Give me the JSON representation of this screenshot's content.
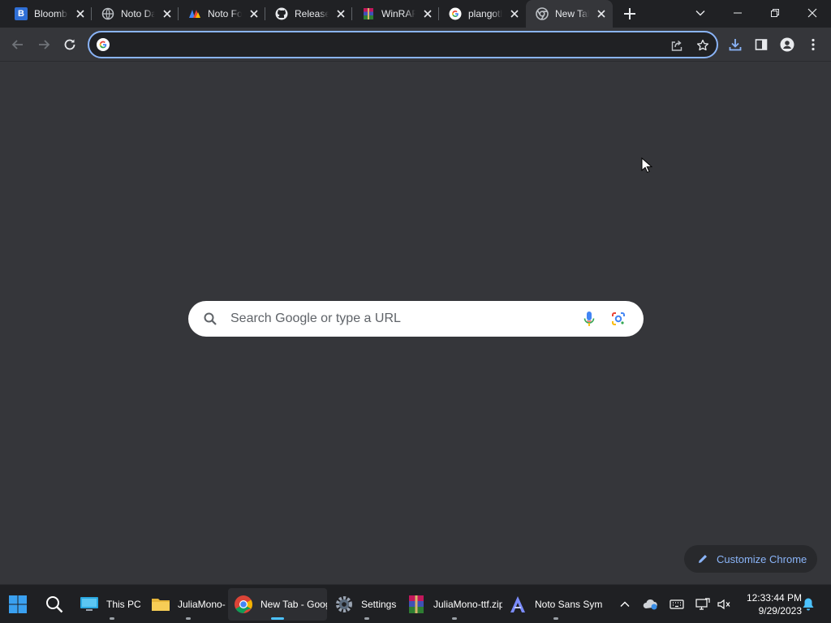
{
  "tabs": [
    {
      "title": "Bloomberg",
      "favicon": "bloomberg-b-icon",
      "active": false
    },
    {
      "title": "Noto Daily",
      "favicon": "globe-icon",
      "active": false
    },
    {
      "title": "Noto Fonts",
      "favicon": "noto-fonts-icon",
      "active": false
    },
    {
      "title": "Releases",
      "favicon": "github-icon",
      "active": false
    },
    {
      "title": "WinRAR",
      "favicon": "winrar-icon",
      "active": false
    },
    {
      "title": "plangothic",
      "favicon": "google-g-icon",
      "active": false
    },
    {
      "title": "New Tab",
      "favicon": "chrome-icon",
      "active": true
    }
  ],
  "omnibox": {
    "value": "",
    "placeholder": ""
  },
  "ntp": {
    "search_placeholder": "Search Google or type a URL",
    "customize_label": "Customize Chrome"
  },
  "taskbar": {
    "items": [
      {
        "label": "This PC",
        "icon": "monitor-icon"
      },
      {
        "label": "JuliaMono-ttf",
        "icon": "folder-icon"
      },
      {
        "label": "New Tab - Google Chrome",
        "icon": "chrome-icon",
        "active": true
      },
      {
        "label": "Settings",
        "icon": "settings-gear-icon"
      },
      {
        "label": "JuliaMono-ttf.zip",
        "icon": "winrar-icon"
      },
      {
        "label": "Noto Sans Symbols",
        "icon": "font-viewer-icon"
      }
    ],
    "time": "12:33:44 PM",
    "date": "9/29/2023"
  },
  "colors": {
    "frame": "#202124",
    "toolbar": "#35363a",
    "accent": "#8ab4f8",
    "taskbar": "#1f2023"
  }
}
